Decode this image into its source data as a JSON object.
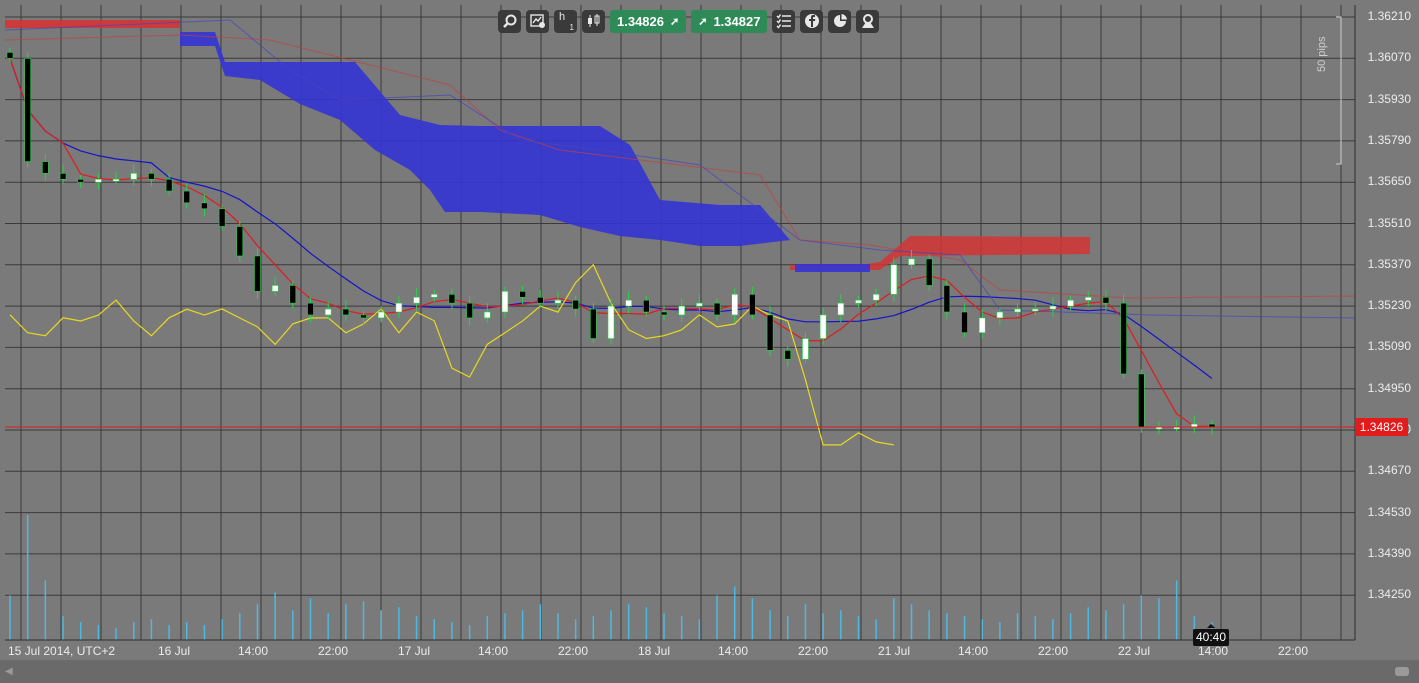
{
  "toolbar": {
    "buttons": [
      "zoom-icon",
      "chart-settings-icon",
      "timeframe-icon",
      "candlestick-icon"
    ],
    "timeframe": "h",
    "timeframe_value": "1",
    "bid_price": "1.34826",
    "ask_price": "1.34827",
    "right_buttons": [
      "indicators-list-icon",
      "facebook-icon",
      "pie-chart-icon",
      "profile-icon"
    ]
  },
  "price_axis": {
    "labels": [
      "1.36210",
      "1.36070",
      "1.35930",
      "1.35790",
      "1.35650",
      "1.35510",
      "1.35370",
      "1.35230",
      "1.35090",
      "1.34950",
      "1.34810",
      "1.34670",
      "1.34530",
      "1.34390",
      "1.34250"
    ],
    "current_price": "1.34826",
    "pips_label": "50 pips"
  },
  "time_axis": {
    "labels": [
      "15 Jul 2014, UTC+2",
      "16 Jul",
      "14:00",
      "22:00",
      "17 Jul",
      "14:00",
      "22:00",
      "18 Jul",
      "14:00",
      "22:00",
      "21 Jul",
      "14:00",
      "22:00",
      "22 Jul",
      "14:00",
      "22:00"
    ]
  },
  "timer": "40:40",
  "colors": {
    "background": "#7a7a7a",
    "grid": "#3a3a3a",
    "candle_up": "#ffffff",
    "candle_down": "#000000",
    "wick": "#2bd24a",
    "kumo_bear": "#3434d4",
    "kumo_bull": "#d43434",
    "tenkan": "#e01b1b",
    "kijun": "#1414c8",
    "chikou": "#e8d820",
    "volume": "#4fb8e0",
    "price_line": "#e31b1b"
  },
  "chart_data": {
    "type": "candlestick",
    "symbol_precision": 5,
    "ylim": [
      1.3416,
      1.3628
    ],
    "ohlc_close_series_approx": [
      1.3607,
      1.3572,
      1.3568,
      1.3566,
      1.3565,
      1.3566,
      1.3566,
      1.3568,
      1.3566,
      1.3562,
      1.3558,
      1.3556,
      1.355,
      1.354,
      1.3528,
      1.353,
      1.3524,
      1.352,
      1.3522,
      1.352,
      1.3519,
      1.3521,
      1.3524,
      1.3526,
      1.3527,
      1.3524,
      1.3519,
      1.3521,
      1.3528,
      1.3526,
      1.3524,
      1.3525,
      1.3522,
      1.3512,
      1.3523,
      1.3525,
      1.3521,
      1.352,
      1.3523,
      1.3524,
      1.352,
      1.3527,
      1.352,
      1.3508,
      1.3505,
      1.3512,
      1.352,
      1.3524,
      1.3525,
      1.3527,
      1.3537,
      1.3539,
      1.353,
      1.3521,
      1.3514,
      1.3519,
      1.3521,
      1.3522,
      1.3522,
      1.3523,
      1.3525,
      1.3526,
      1.3524,
      1.35,
      1.3482,
      1.3482,
      1.3482,
      1.3483,
      1.3482
    ],
    "volume_approx": [
      15,
      42,
      20,
      8,
      6,
      5,
      4,
      6,
      7,
      5,
      6,
      5,
      7,
      9,
      12,
      16,
      10,
      14,
      9,
      12,
      13,
      10,
      11,
      8,
      7,
      6,
      5,
      8,
      9,
      10,
      12,
      9,
      7,
      8,
      10,
      12,
      11,
      9,
      8,
      7,
      15,
      18,
      14,
      10,
      8,
      12,
      9,
      10,
      8,
      7,
      14,
      12,
      10,
      9,
      8,
      7,
      6,
      9,
      8,
      7,
      9,
      11,
      10,
      12,
      15,
      14,
      20,
      8,
      6
    ]
  }
}
